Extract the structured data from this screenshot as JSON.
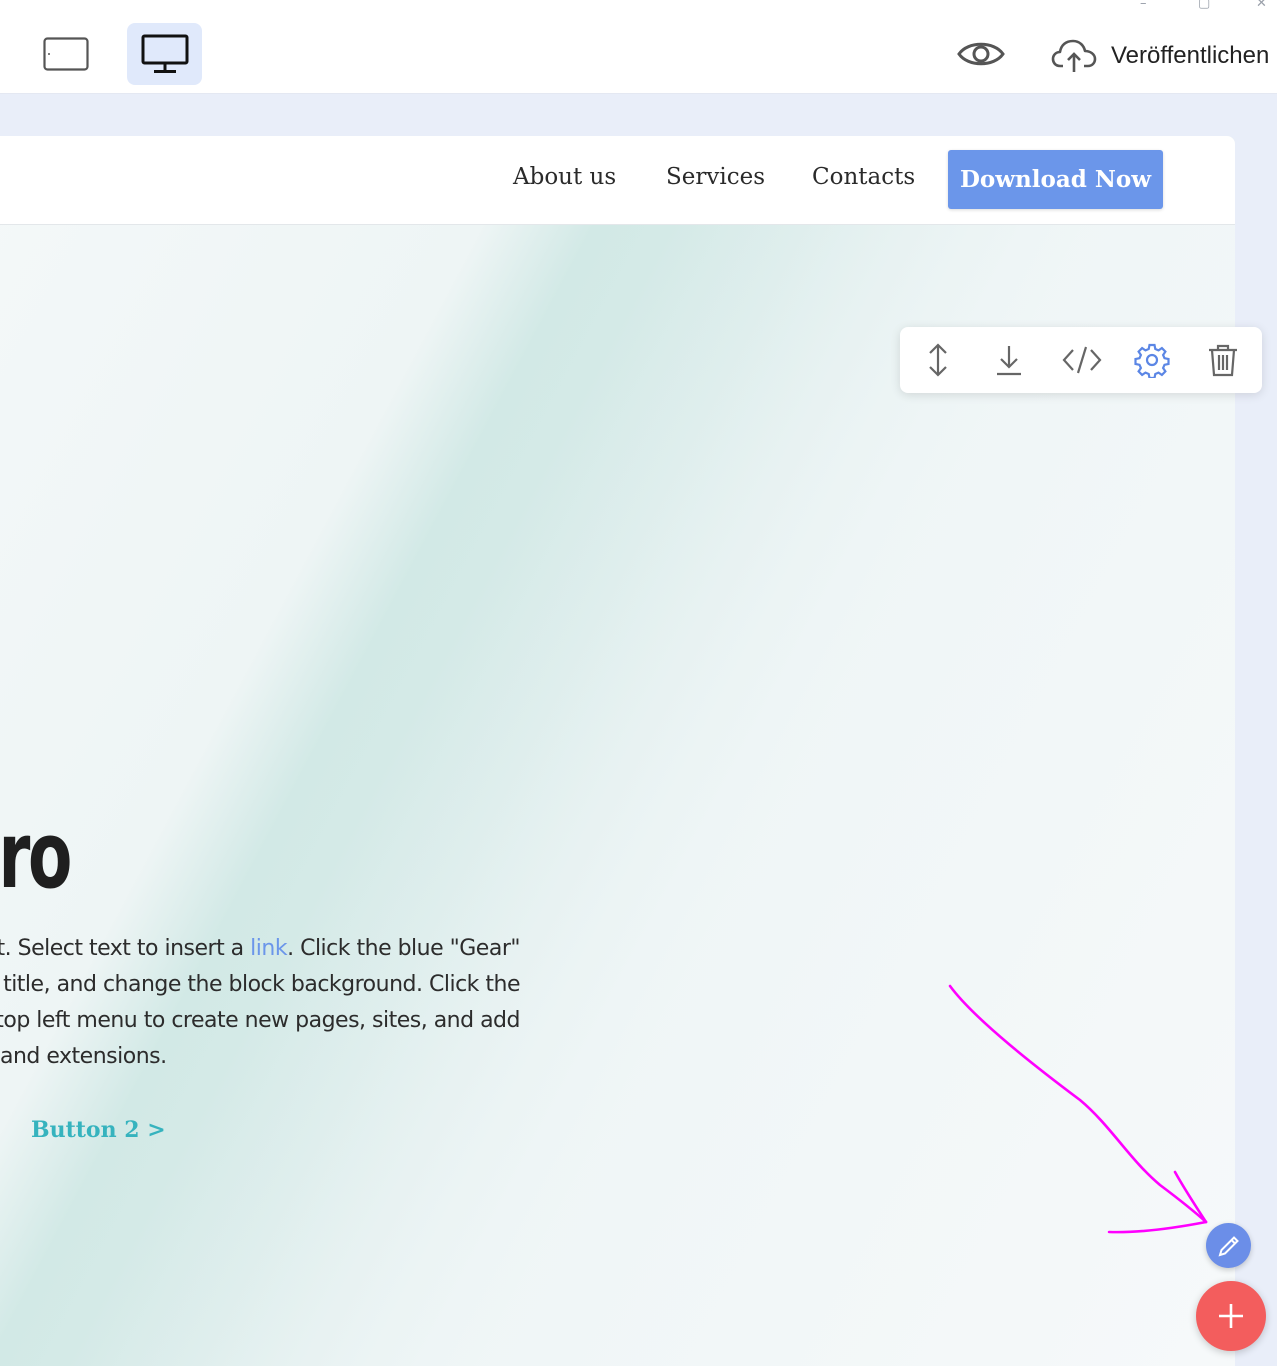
{
  "window": {
    "minimize_glyph": "–",
    "maximize_glyph": "▢",
    "close_glyph": "✕"
  },
  "toolbar": {
    "devices": [
      {
        "icon": "tablet-icon",
        "active": false
      },
      {
        "icon": "desktop-icon",
        "active": true
      }
    ],
    "preview_icon": "eye-icon",
    "publish_icon": "cloud-upload-icon",
    "publish_label": "Veröffentlichen"
  },
  "site": {
    "nav": {
      "links": [
        "About us",
        "Services",
        "Contacts"
      ],
      "cta_label": "Download Now"
    },
    "block_toolbar": {
      "icons": [
        "move-icon",
        "download-icon",
        "code-icon",
        "gear-icon",
        "trash-icon"
      ]
    },
    "hero": {
      "title": "een Intro",
      "text_lines": [
        {
          "before": "le it. Select text to insert a ",
          "link": "link",
          "after": ". Click the blue \"Gear\""
        },
        {
          "before": "ttons, text, title, and change the block background. Click the"
        },
        {
          "before": "k. Use the top left menu to create new pages, sites, and add"
        },
        {
          "before": "and extensions."
        }
      ],
      "button2_label": "Button 2 >"
    }
  },
  "fabs": {
    "edit_icon": "pencil-icon",
    "add_icon": "plus-icon"
  },
  "colors": {
    "accent": "#6b96ea",
    "add_button": "#f35d5d",
    "button2": "#36b3be",
    "annotation": "#ff00ff"
  }
}
